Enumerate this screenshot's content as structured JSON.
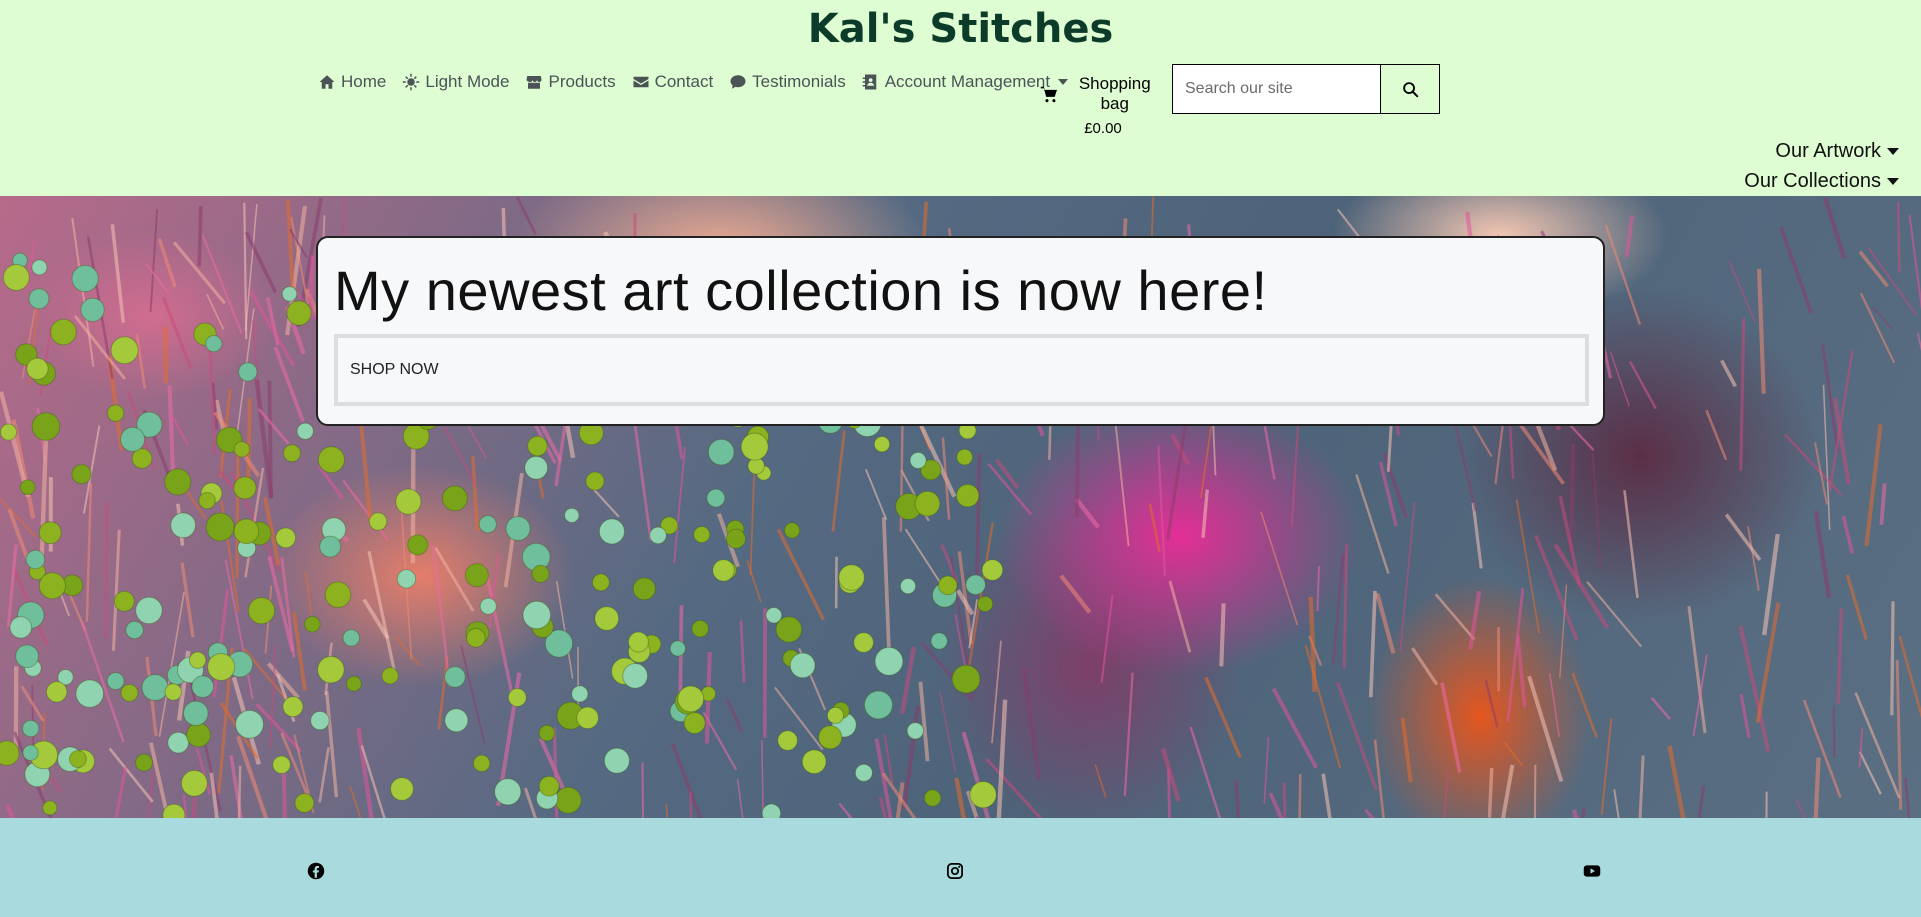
{
  "header": {
    "brand": "Kal's Stitches",
    "nav": [
      {
        "label": "Home",
        "icon": "home-icon"
      },
      {
        "label": "Light Mode",
        "icon": "sun-icon"
      },
      {
        "label": "Products",
        "icon": "store-icon"
      },
      {
        "label": "Contact",
        "icon": "envelope-icon"
      },
      {
        "label": "Testimonials",
        "icon": "comment-icon"
      },
      {
        "label": "Account Management",
        "icon": "address-book-icon"
      }
    ],
    "bag": {
      "label": "Shopping bag",
      "total": "£0.00",
      "icon": "cart-icon"
    },
    "search": {
      "placeholder": "Search our site",
      "value": ""
    },
    "dropdowns": [
      "Our Artwork",
      "Our Collections"
    ]
  },
  "hero": {
    "title": "My newest art collection is now here!",
    "button": "SHOP NOW"
  },
  "footer": {
    "icons": [
      "facebook-icon",
      "instagram-icon",
      "youtube-icon"
    ]
  },
  "colors": {
    "header_bg": "#dffdd3",
    "brand": "#0c3b2a",
    "footer_bg": "#a9dbde"
  }
}
